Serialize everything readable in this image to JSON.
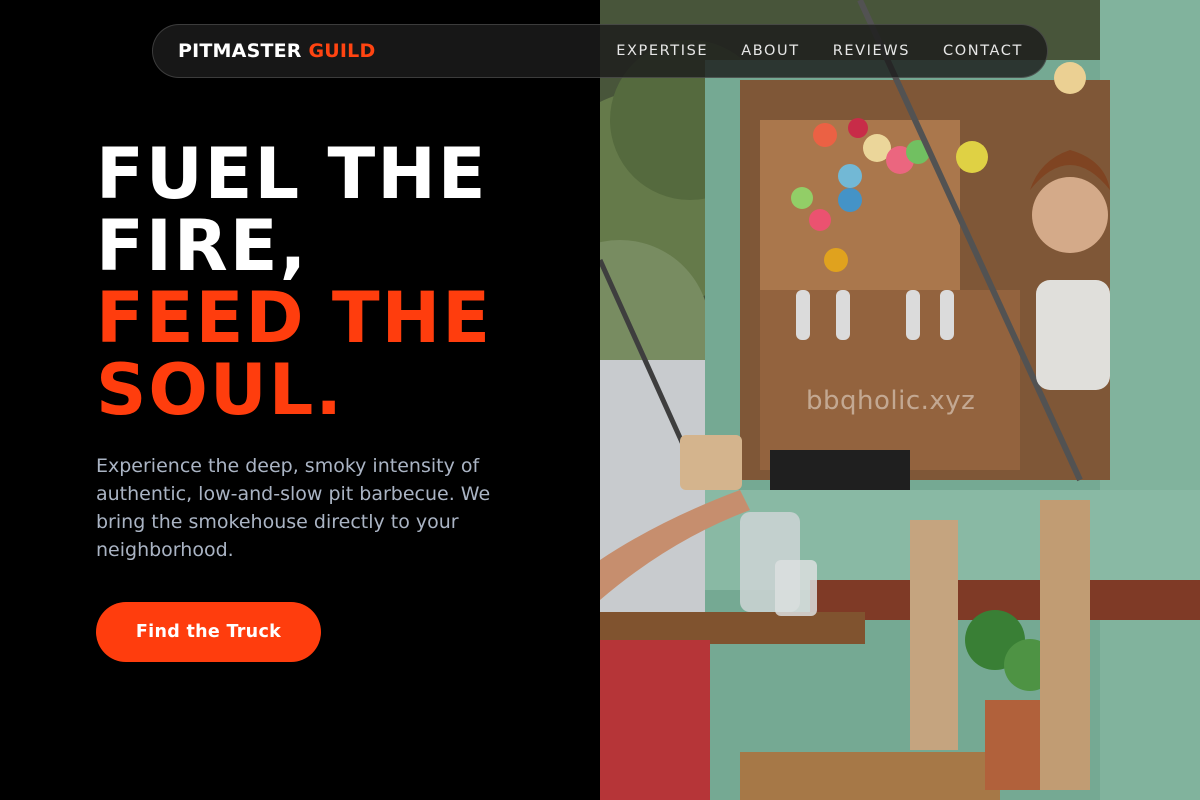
{
  "brand": {
    "part1": "PITMASTER",
    "part2": "GUILD"
  },
  "nav": {
    "items": [
      {
        "label": "EXPERTISE"
      },
      {
        "label": "ABOUT"
      },
      {
        "label": "REVIEWS"
      },
      {
        "label": "CONTACT"
      }
    ]
  },
  "hero": {
    "line1": "FUEL THE",
    "line2": "FIRE,",
    "line3": "FEED THE",
    "line4": "SOUL.",
    "description": "Experience the deep, smoky intensity of authentic, low-and-slow pit barbecue. We bring the smokehouse directly to your neighborhood.",
    "cta_label": "Find the Truck"
  },
  "photo": {
    "watermark": "bbqholic.xyz"
  },
  "colors": {
    "accent": "#ff3d0d",
    "background": "#000000",
    "body_text": "#aab4c4"
  }
}
